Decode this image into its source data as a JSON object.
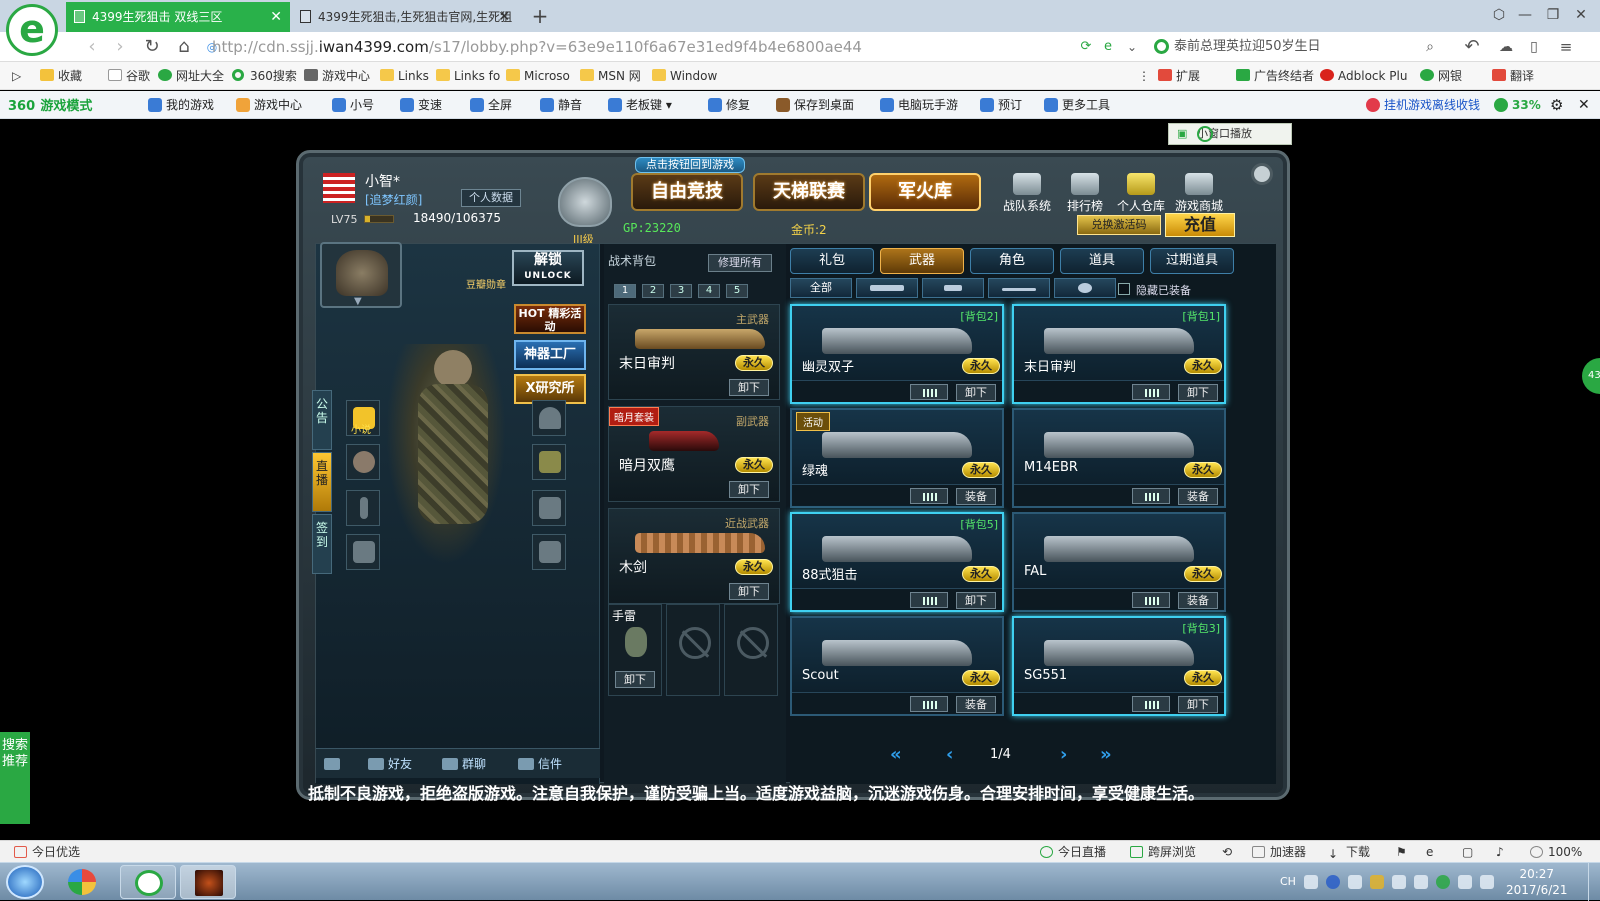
{
  "browser": {
    "tabs": [
      {
        "title": "4399生死狙击 双线三区",
        "active": true
      },
      {
        "title": "4399生死狙击,生死狙击官网,生死狙",
        "active": false
      }
    ],
    "url_prefix": "http://cdn.ssjj.",
    "url_host": "iwan4399.com",
    "url_path": "/s17/lobby.php?v=63e9e110f6a67e31ed9f4b4e6800ae44",
    "search_text": "泰前总理英拉迎50岁生日"
  },
  "bookmarks": [
    "收藏",
    "谷歌",
    "网址大全",
    "360搜索",
    "游戏中心",
    "Links",
    "Links fo",
    "Microso",
    "MSN 网",
    "Window"
  ],
  "bookmark_right": [
    "扩展",
    "广告终结者",
    "Adblock Plu",
    "网银",
    "翻译"
  ],
  "gamebar": {
    "logo": "360",
    "logo_suffix": "游戏模式",
    "items": [
      "我的游戏",
      "游戏中心",
      "小号",
      "变速",
      "全屏",
      "静音",
      "老板键",
      "修复",
      "保存到桌面",
      "电脑玩手游",
      "预订",
      "更多工具"
    ],
    "right_text": "挂机游戏离线收钱",
    "percent": "33%"
  },
  "game": {
    "small_window": "小窗口播放",
    "player": {
      "name": "小智*",
      "group": "[追梦红颜]",
      "info_btn": "个人数据",
      "level": "LV75",
      "xp": "18490/106375",
      "rank": "III级",
      "xp_fraction": 0.17
    },
    "top_hint": "点击按钮回到游戏",
    "main_tabs": [
      "自由竞技",
      "天梯联赛",
      "军火库"
    ],
    "nav": [
      "战队系统",
      "排行榜",
      "个人仓库",
      "游戏商城"
    ],
    "gp": "GP:23220",
    "gold": "金币:2",
    "redeem": "兑换激活码",
    "topup": "充值",
    "left": {
      "medal": "豆瓣勋章",
      "unlock": "解锁",
      "unlock_sub": "UNLOCK",
      "promos": [
        "HOT 精彩活动",
        "神器工厂",
        "X研究所"
      ],
      "vtabs": [
        "公告",
        "直播",
        "签到"
      ],
      "book_label": "小说",
      "bottom": [
        "好友",
        "群聊",
        "信件"
      ]
    },
    "loadout": {
      "title": "战术背包",
      "repair": "修理所有",
      "bags": [
        "1",
        "2",
        "3",
        "4",
        "5"
      ],
      "slots": [
        {
          "type": "主武器",
          "name": "末日审判",
          "perm": "永久",
          "action": "卸下",
          "tag": ""
        },
        {
          "type": "副武器",
          "name": "暗月双鹰",
          "perm": "永久",
          "action": "卸下",
          "tag": "暗月套装"
        },
        {
          "type": "近战武器",
          "name": "木剑",
          "perm": "永久",
          "action": "卸下",
          "tag": ""
        }
      ],
      "grenade": {
        "name": "手雷",
        "action": "卸下"
      }
    },
    "arsenal": {
      "tabs": [
        "礼包",
        "武器",
        "角色",
        "道具",
        "过期道具"
      ],
      "filters": [
        "全部"
      ],
      "hide_equipped": "隐藏已装备",
      "weapons": [
        {
          "name": "幽灵双子",
          "bag": "[背包2]",
          "perm": "永久",
          "action": "卸下",
          "equipped": true,
          "tag": ""
        },
        {
          "name": "末日审判",
          "bag": "[背包1]",
          "perm": "永久",
          "action": "卸下",
          "equipped": true,
          "tag": ""
        },
        {
          "name": "绿魂",
          "bag": "",
          "perm": "永久",
          "action": "装备",
          "equipped": false,
          "tag": "活动"
        },
        {
          "name": "M14EBR",
          "bag": "",
          "perm": "永久",
          "action": "装备",
          "equipped": false,
          "tag": ""
        },
        {
          "name": "88式狙击",
          "bag": "[背包5]",
          "perm": "永久",
          "action": "卸下",
          "equipped": true,
          "tag": ""
        },
        {
          "name": "FAL",
          "bag": "",
          "perm": "永久",
          "action": "装备",
          "equipped": false,
          "tag": ""
        },
        {
          "name": "Scout",
          "bag": "",
          "perm": "永久",
          "action": "装备",
          "equipped": false,
          "tag": ""
        },
        {
          "name": "SG551",
          "bag": "[背包3]",
          "perm": "永久",
          "action": "卸下",
          "equipped": true,
          "tag": ""
        }
      ],
      "page": "1/4"
    },
    "warning": "抵制不良游戏，拒绝盗版游戏。注意自我保护，谨防受骗上当。适度游戏益脑，沉迷游戏伤身。合理安排时间，享受健康生活。",
    "search_rec": "搜索推荐"
  },
  "statusbar": {
    "left": "今日优选",
    "right": [
      "今日直播",
      "跨屏浏览",
      "加速器",
      "下载"
    ],
    "zoom": "100%"
  },
  "taskbar": {
    "time": "20:27",
    "date": "2017/6/21",
    "lang": "CH"
  }
}
